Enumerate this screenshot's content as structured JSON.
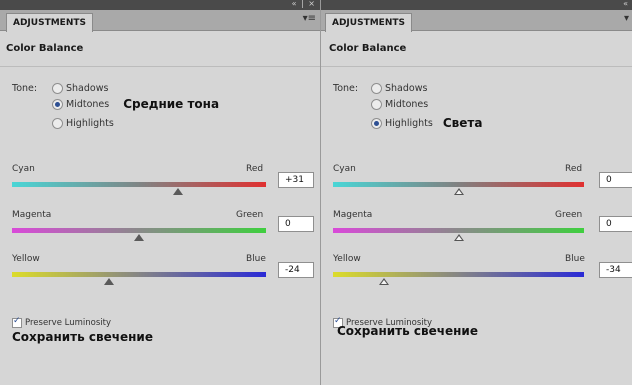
{
  "panels": [
    {
      "tab_label": "ADJUSTMENTS",
      "title": "Color Balance",
      "tone": {
        "label": "Tone:",
        "options": [
          "Shadows",
          "Midtones",
          "Highlights"
        ],
        "selected": "Midtones",
        "annotation": "Средние тона"
      },
      "sliders": [
        {
          "left": "Cyan",
          "right": "Red",
          "value": "+31"
        },
        {
          "left": "Magenta",
          "right": "Green",
          "value": "0"
        },
        {
          "left": "Yellow",
          "right": "Blue",
          "value": "-24"
        }
      ],
      "preserve": {
        "label": "Preserve Luminosity",
        "checked": true,
        "annotation": "Сохранить свечение"
      }
    },
    {
      "tab_label": "ADJUSTMENTS",
      "title": "Color Balance",
      "tone": {
        "label": "Tone:",
        "options": [
          "Shadows",
          "Midtones",
          "Highlights"
        ],
        "selected": "Highlights",
        "annotation": "Света"
      },
      "sliders": [
        {
          "left": "Cyan",
          "right": "Red",
          "value": "0"
        },
        {
          "left": "Magenta",
          "right": "Green",
          "value": "0"
        },
        {
          "left": "Yellow",
          "right": "Blue",
          "value": "-34"
        }
      ],
      "preserve": {
        "label": "Preserve Luminosity",
        "checked": true,
        "annotation": "Сохранить свечение"
      }
    }
  ],
  "colors": {
    "cyan": "#49d6d6",
    "red": "#e03030",
    "magenta": "#d94ad9",
    "green": "#3fcf3f",
    "yellow": "#dcdc2a",
    "blue": "#2a2ad6",
    "radio_dot": "#2d4f93"
  },
  "icons": {
    "collapse": "double-chevron-icon",
    "close": "close-icon",
    "menu": "panel-menu-icon"
  }
}
